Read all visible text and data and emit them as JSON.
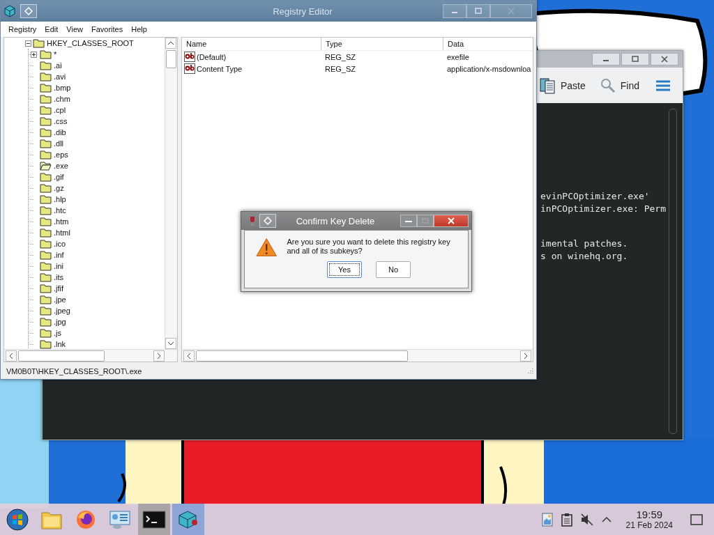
{
  "terminal": {
    "toolbar": [
      {
        "kind": "paste",
        "label": "Paste"
      },
      {
        "kind": "find",
        "label": "Find"
      }
    ],
    "blocks": [
      [
        "evinPCOptimizer.exe'",
        "inPCOptimizer.exe: Perm"
      ],
      [
        "imental patches.",
        "s on winehq.org."
      ]
    ]
  },
  "registry_editor": {
    "title": "Registry Editor",
    "menu": [
      "Registry",
      "Edit",
      "View",
      "Favorites",
      "Help"
    ],
    "tree": {
      "label": "HKEY_CLASSES_ROOT",
      "expanded": true,
      "children": [
        {
          "label": "*",
          "kind": "collapsed",
          "selected": false
        },
        {
          "label": ".ai",
          "kind": "leaf",
          "selected": false
        },
        {
          "label": ".avi",
          "kind": "leaf",
          "selected": false
        },
        {
          "label": ".bmp",
          "kind": "leaf",
          "selected": false
        },
        {
          "label": ".chm",
          "kind": "leaf",
          "selected": false
        },
        {
          "label": ".cpl",
          "kind": "leaf",
          "selected": false
        },
        {
          "label": ".css",
          "kind": "leaf",
          "selected": false
        },
        {
          "label": ".dib",
          "kind": "leaf",
          "selected": false
        },
        {
          "label": ".dll",
          "kind": "leaf",
          "selected": false
        },
        {
          "label": ".eps",
          "kind": "leaf",
          "selected": false
        },
        {
          "label": ".exe",
          "kind": "leaf",
          "selected": true
        },
        {
          "label": ".gif",
          "kind": "leaf",
          "selected": false
        },
        {
          "label": ".gz",
          "kind": "leaf",
          "selected": false
        },
        {
          "label": ".hlp",
          "kind": "leaf",
          "selected": false
        },
        {
          "label": ".htc",
          "kind": "leaf",
          "selected": false
        },
        {
          "label": ".htm",
          "kind": "leaf",
          "selected": false
        },
        {
          "label": ".html",
          "kind": "leaf",
          "selected": false
        },
        {
          "label": ".ico",
          "kind": "leaf",
          "selected": false
        },
        {
          "label": ".inf",
          "kind": "leaf",
          "selected": false
        },
        {
          "label": ".ini",
          "kind": "leaf",
          "selected": false
        },
        {
          "label": ".its",
          "kind": "leaf",
          "selected": false
        },
        {
          "label": ".jfif",
          "kind": "leaf",
          "selected": false
        },
        {
          "label": ".jpe",
          "kind": "leaf",
          "selected": false
        },
        {
          "label": ".jpeg",
          "kind": "leaf",
          "selected": false
        },
        {
          "label": ".jpg",
          "kind": "leaf",
          "selected": false
        },
        {
          "label": ".js",
          "kind": "leaf",
          "selected": false
        },
        {
          "label": ".lnk",
          "kind": "leaf",
          "selected": false
        }
      ]
    },
    "columns": [
      "Name",
      "Type",
      "Data"
    ],
    "rows": [
      {
        "name": "(Default)",
        "type": "REG_SZ",
        "data": "exefile"
      },
      {
        "name": "Content Type",
        "type": "REG_SZ",
        "data": "application/x-msdownloa"
      }
    ],
    "status_bar": "VM0B0T\\HKEY_CLASSES_ROOT\\.exe"
  },
  "dialog": {
    "title": "Confirm Key Delete",
    "message": "Are you sure you want to delete this registry key and all of its subkeys?",
    "buttons": [
      {
        "label": "Yes",
        "focused": true
      },
      {
        "label": "No",
        "focused": false
      }
    ]
  },
  "taskbar": {
    "apps": [
      {
        "kind": "start",
        "open": false,
        "focused": false
      },
      {
        "kind": "files",
        "open": false,
        "focused": false
      },
      {
        "kind": "browser",
        "open": false,
        "focused": false
      },
      {
        "kind": "settings",
        "open": false,
        "focused": false
      },
      {
        "kind": "terminal",
        "open": true,
        "focused": false
      },
      {
        "kind": "registry",
        "open": true,
        "focused": true
      }
    ],
    "tray": [
      {
        "kind": "notes"
      },
      {
        "kind": "clipboard"
      },
      {
        "kind": "volume",
        "muted": true
      },
      {
        "kind": "expand"
      }
    ],
    "clock": {
      "time": "19:59",
      "date": "21 Feb 2024"
    }
  }
}
